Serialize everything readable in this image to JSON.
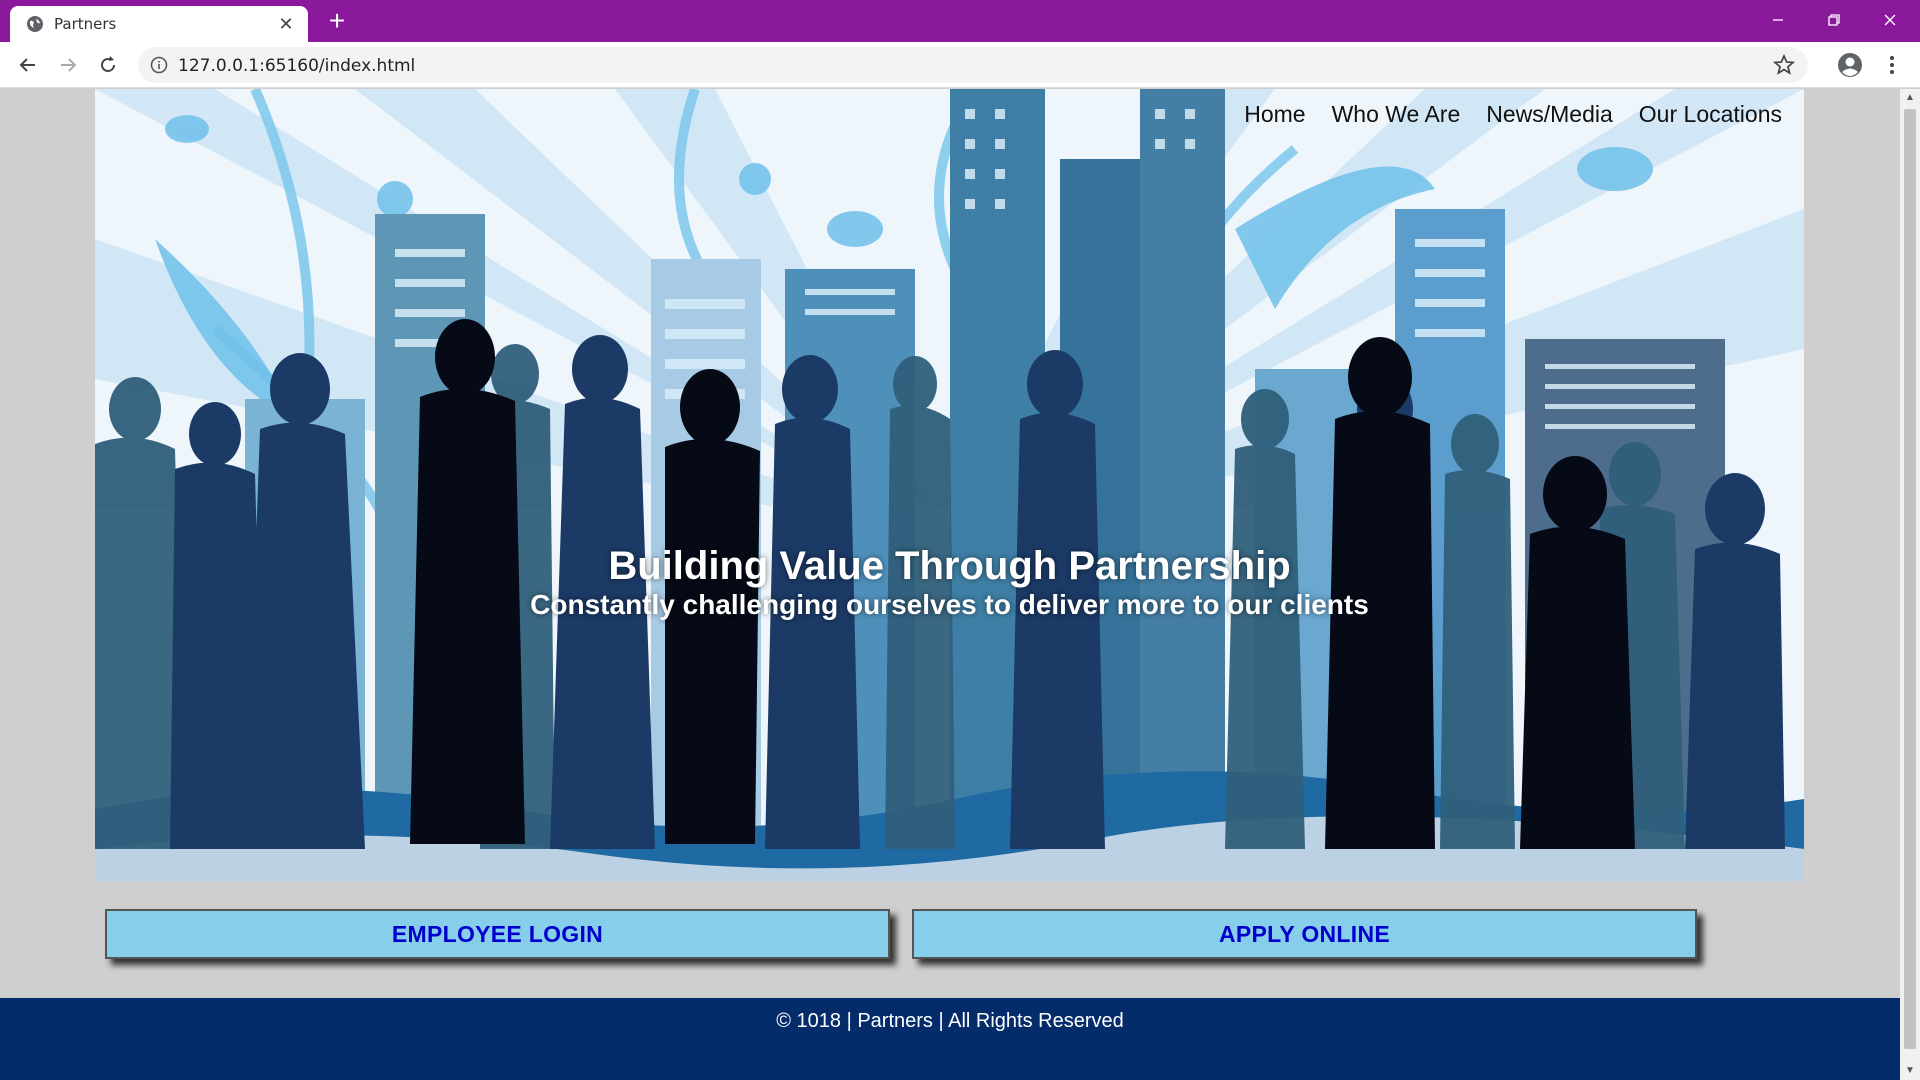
{
  "browser": {
    "tab_title": "Partners",
    "url": "127.0.0.1:65160/index.html",
    "frame_color": "#8a1a9b"
  },
  "nav": {
    "items": [
      {
        "label": "Home"
      },
      {
        "label": "Who We Are"
      },
      {
        "label": "News/Media"
      },
      {
        "label": "Our Locations"
      }
    ]
  },
  "hero": {
    "title": "Building Value Through Partnership",
    "subtitle": "Constantly challenging ourselves to deliver more to our clients"
  },
  "buttons": {
    "employee_login": "EMPLOYEE LOGIN",
    "apply_online": "APPLY ONLINE",
    "background_color": "#87ceeb",
    "text_color": "#0000cc"
  },
  "footer": {
    "text": "© 1018 | Partners | All Rights Reserved",
    "background_color": "#042c6b"
  },
  "icons": {
    "favicon": "globe-icon",
    "close": "close-icon",
    "new_tab": "plus-icon",
    "back": "back-arrow-icon",
    "forward": "forward-arrow-icon",
    "reload": "reload-icon",
    "info": "info-icon",
    "bookmark": "star-icon",
    "profile": "profile-icon",
    "menu": "kebab-menu-icon"
  }
}
